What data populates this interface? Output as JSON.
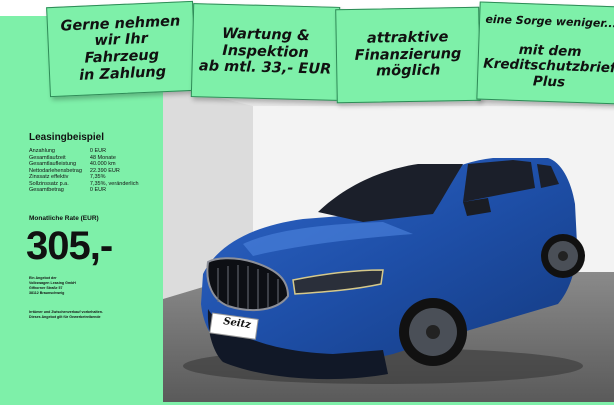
{
  "signs": [
    {
      "text": "Gerne nehmen\nwir Ihr\nFahrzeug\nin Zahlung"
    },
    {
      "text": "Wartung &\nInspektion\nab mtl. 33,- EUR"
    },
    {
      "text": "attraktive\nFinanzierung\nmöglich"
    },
    {
      "line1": "eine Sorge weniger...",
      "rest": "mit dem\nKreditschutzbrief\nPlus"
    }
  ],
  "leasing": {
    "title": "Leasingbeispiel",
    "rows": [
      {
        "label": "Anzahlung",
        "value": "0 EUR"
      },
      {
        "label": "Gesamtlaufzeit",
        "value": "48 Monate"
      },
      {
        "label": "Gesamtlaufleistung",
        "value": "40.000 km"
      },
      {
        "label": "Nettodarlehensbetrag",
        "value": "22.390 EUR"
      },
      {
        "label": "Zinssatz effektiv",
        "value": "7,35%"
      },
      {
        "label": "Sollzinssatz p.a.",
        "value": "7,35%, veränderlich"
      },
      {
        "label": "Gesamtbetrag",
        "value": "0 EUR"
      }
    ],
    "rate_label": "Monatliche Rate (EUR)",
    "rate_value": "305,-",
    "provider_lines": [
      "Ein Angebot der",
      "Volkswagen Leasing GmbH",
      "Gifhorner Straße 57",
      "38112 Braunschweig"
    ],
    "disclaimer_lines": [
      "Irrtümer und Zwischenverkauf vorbehalten.",
      "Dieses Angebot gilt für Gewerbetreibende"
    ]
  },
  "photo": {
    "plate_text": "Seitz",
    "car_color": "#1e4fa8"
  },
  "colors": {
    "brand_green": "#7ef0a9"
  }
}
